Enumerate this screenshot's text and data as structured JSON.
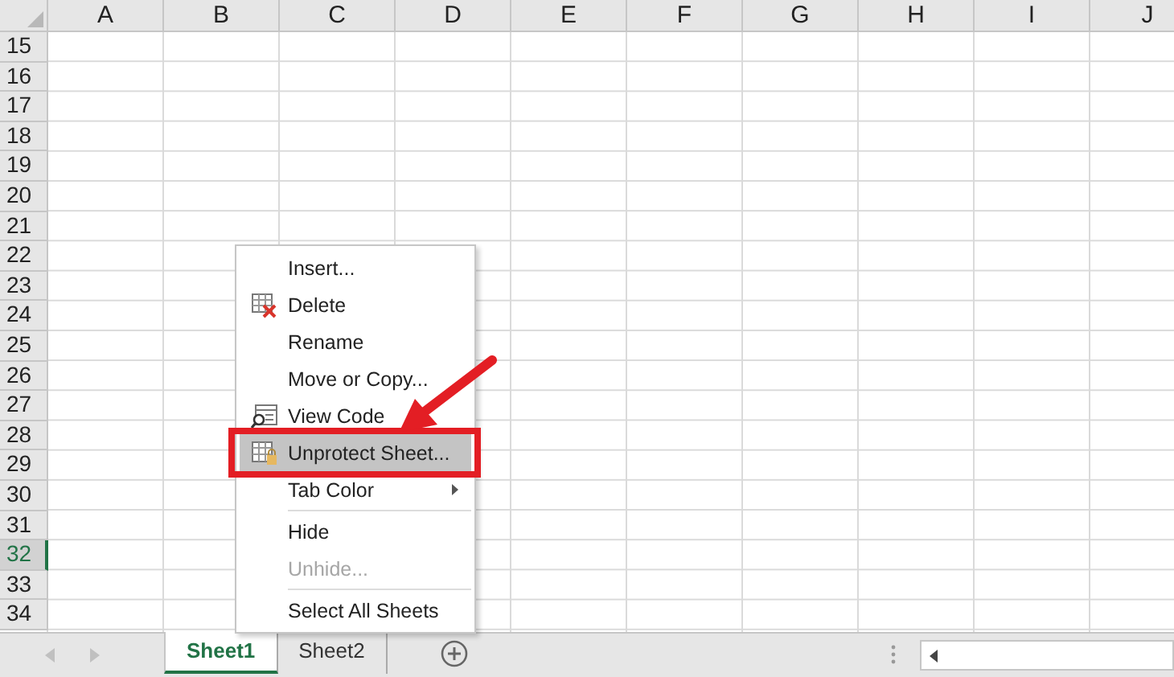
{
  "columns": [
    {
      "label": "A"
    },
    {
      "label": "B"
    },
    {
      "label": "C"
    },
    {
      "label": "D"
    },
    {
      "label": "E"
    },
    {
      "label": "F"
    },
    {
      "label": "G"
    },
    {
      "label": "H"
    },
    {
      "label": "I"
    },
    {
      "label": "J"
    }
  ],
  "rows": [
    {
      "label": "15",
      "selected": false
    },
    {
      "label": "16",
      "selected": false
    },
    {
      "label": "17",
      "selected": false
    },
    {
      "label": "18",
      "selected": false
    },
    {
      "label": "19",
      "selected": false
    },
    {
      "label": "20",
      "selected": false
    },
    {
      "label": "21",
      "selected": false
    },
    {
      "label": "22",
      "selected": false
    },
    {
      "label": "23",
      "selected": false
    },
    {
      "label": "24",
      "selected": false
    },
    {
      "label": "25",
      "selected": false
    },
    {
      "label": "26",
      "selected": false
    },
    {
      "label": "27",
      "selected": false
    },
    {
      "label": "28",
      "selected": false
    },
    {
      "label": "29",
      "selected": false
    },
    {
      "label": "30",
      "selected": false
    },
    {
      "label": "31",
      "selected": false
    },
    {
      "label": "32",
      "selected": true
    },
    {
      "label": "33",
      "selected": false
    },
    {
      "label": "34",
      "selected": false
    }
  ],
  "context_menu": {
    "items": [
      {
        "kind": "item",
        "label": "Insert...",
        "selected": false,
        "disabled": false
      },
      {
        "kind": "delete",
        "label": "Delete",
        "selected": false,
        "disabled": false
      },
      {
        "kind": "item",
        "label": "Rename",
        "selected": false,
        "disabled": false
      },
      {
        "kind": "item",
        "label": "Move or Copy...",
        "selected": false,
        "disabled": false
      },
      {
        "kind": "code",
        "label": "View Code",
        "selected": false,
        "disabled": false
      },
      {
        "kind": "protect",
        "label": "Unprotect Sheet...",
        "selected": true,
        "disabled": false
      },
      {
        "kind": "submenu",
        "label": "Tab Color",
        "selected": false,
        "disabled": false
      },
      {
        "kind": "separator"
      },
      {
        "kind": "item",
        "label": "Hide",
        "selected": false,
        "disabled": false
      },
      {
        "kind": "item",
        "label": "Unhide...",
        "selected": false,
        "disabled": true
      },
      {
        "kind": "separator"
      },
      {
        "kind": "item",
        "label": "Select All Sheets",
        "selected": false,
        "disabled": false
      }
    ]
  },
  "sheet_tabs": [
    {
      "label": "Sheet1",
      "selected": true
    },
    {
      "label": "Sheet2",
      "selected": false
    }
  ]
}
